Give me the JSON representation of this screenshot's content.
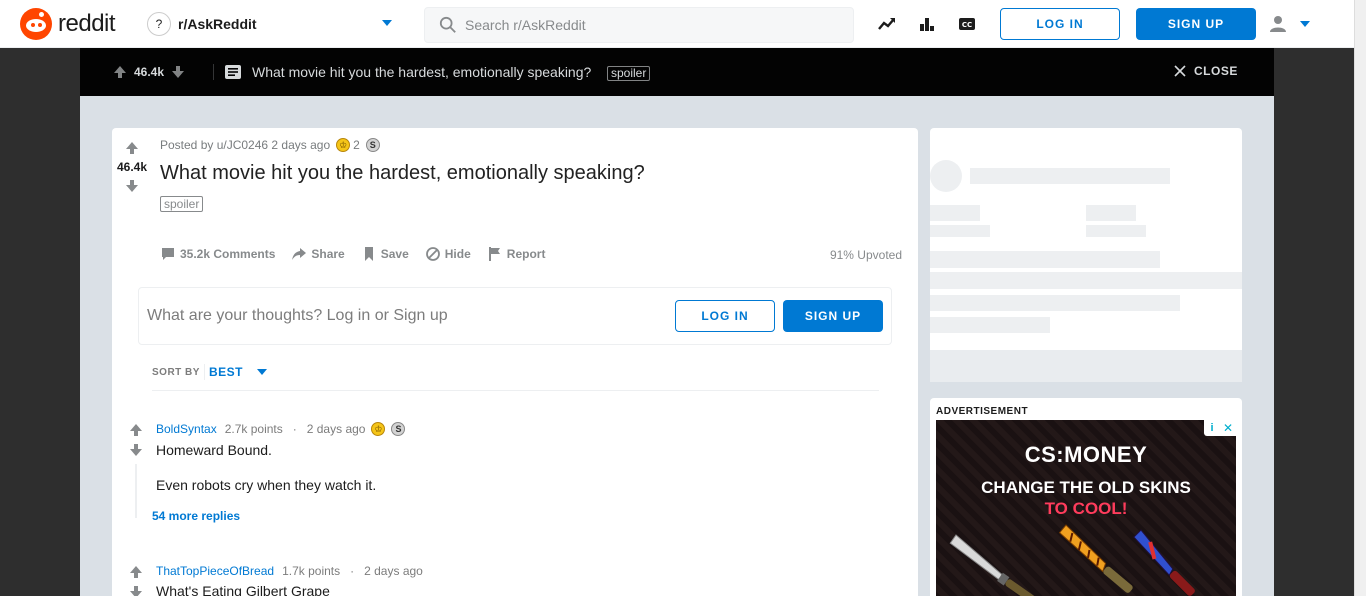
{
  "header": {
    "logo_text": "reddit",
    "subreddit": "r/AskReddit",
    "search_placeholder": "Search r/AskReddit",
    "login_label": "LOG IN",
    "signup_label": "SIGN UP"
  },
  "sticky_bar": {
    "score": "46.4k",
    "title": "What movie hit you the hardest, emotionally speaking?",
    "spoiler": "spoiler",
    "close_label": "CLOSE"
  },
  "post": {
    "meta": "Posted by u/JC0246 2 days ago",
    "award_count": "2",
    "score": "46.4k",
    "title": "What movie hit you the hardest, emotionally speaking?",
    "spoiler": "spoiler",
    "actions": {
      "comments": "35.2k Comments",
      "share": "Share",
      "save": "Save",
      "hide": "Hide",
      "report": "Report"
    },
    "upvoted": "91% Upvoted"
  },
  "comment_box": {
    "prompt": "What are your thoughts? Log in or Sign up",
    "login_label": "LOG IN",
    "signup_label": "SIGN UP"
  },
  "sort": {
    "label": "SORT BY",
    "value": "BEST"
  },
  "comments": [
    {
      "author": "BoldSyntax",
      "points": "2.7k points",
      "time": "2 days ago",
      "body": [
        "Homeward Bound.",
        "Even robots cry when they watch it."
      ],
      "more": "54 more replies"
    },
    {
      "author": "ThatTopPieceOfBread",
      "points": "1.7k points",
      "time": "2 days ago",
      "body": [
        "What's Eating Gilbert Grape"
      ]
    }
  ],
  "ad": {
    "label": "ADVERTISEMENT",
    "brand": "CS:MONEY",
    "line1": "CHANGE THE OLD SKINS",
    "line2": "TO COOL!"
  },
  "colors": {
    "brand_orange": "#ff4500",
    "accent_blue": "#0079d3",
    "overlay_bg": "#dae0e6",
    "dark_bar": "#030303"
  }
}
